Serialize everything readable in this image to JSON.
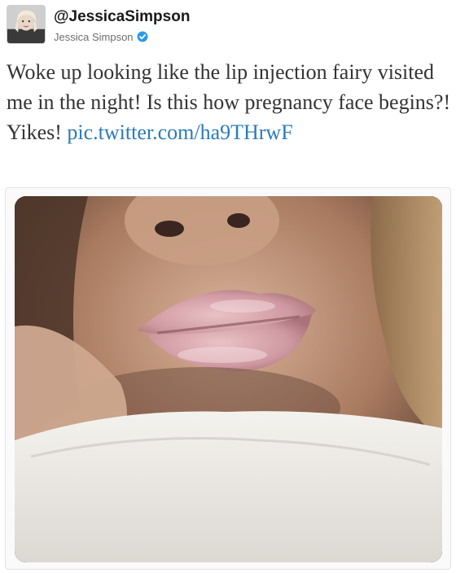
{
  "tweet": {
    "handle": "@JessicaSimpson",
    "display_name": "Jessica Simpson",
    "verified": true,
    "text_parts": {
      "body": "Woke up looking like the lip injection fairy visited me in the night! Is this how pregnancy face begins?! Yikes!",
      "link": "pic.twitter.com/ha9THrwF"
    },
    "media": {
      "kind": "photo",
      "subject": "close-up-lips-photo"
    }
  },
  "colors": {
    "link": "#2b7bb9",
    "verified_badge": "#2b9be8",
    "text": "#333333",
    "handle": "#1a1a1a"
  },
  "icons": {
    "verified": "verified-badge-icon"
  }
}
